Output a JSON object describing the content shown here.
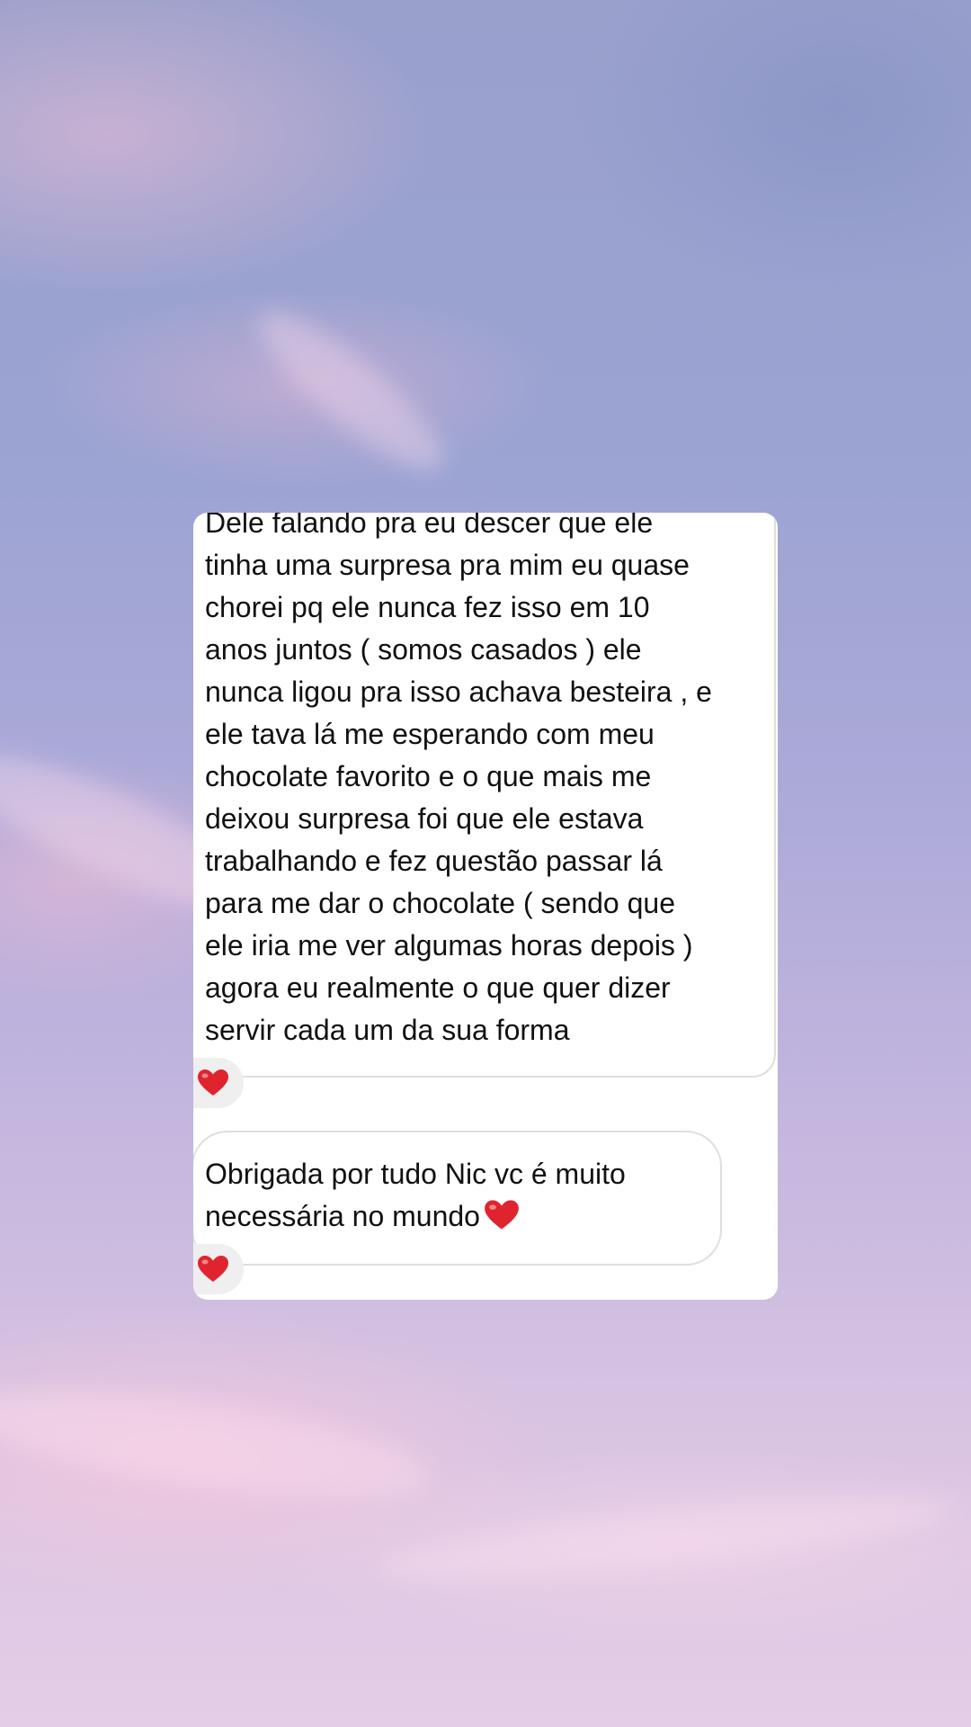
{
  "background": {
    "colors": {
      "sky_top": "#9aa0cc",
      "sky_bottom": "#e4cde6",
      "cloud_pink": "#f0bcd4"
    }
  },
  "messages": [
    {
      "text": "Dele falando pra eu descer que ele\ntinha uma surpresa pra mim eu quase\nchorei pq ele nunca fez isso em 10\nanos juntos ( somos casados ) ele\nnunca ligou pra isso achava besteira , e\nele tava lá me esperando com meu\nchocolate favorito e o que mais me\ndeixou surpresa foi que ele estava\ntrabalhando e fez questão passar lá\npara me dar o chocolate ( sendo que\nele iria me ver algumas horas depois )\nagora eu realmente o que quer dizer\nservir cada um da sua forma",
      "reaction": "❤️",
      "reaction_icon": "heart-icon"
    },
    {
      "text": "Obrigada por tudo Nic vc é muito\nnecessária no mundo",
      "trailing_emoji": "❤️",
      "trailing_icon": "heart-icon",
      "reaction": "❤️",
      "reaction_icon": "heart-icon"
    }
  ],
  "colors": {
    "panel_bg": "#ffffff",
    "bubble_border": "#dedede",
    "reaction_bg": "#efefef",
    "heart": "#e0242f",
    "text": "#111111"
  }
}
